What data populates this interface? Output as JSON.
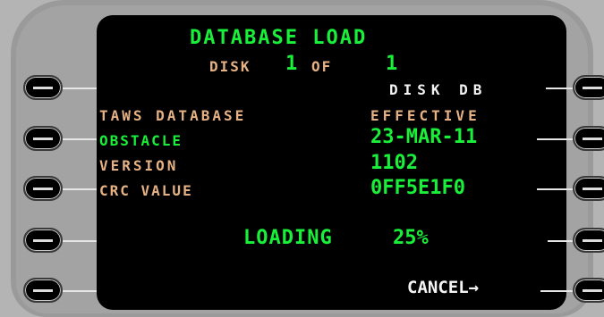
{
  "header": {
    "title": "DATABASE LOAD",
    "disk_label": "DISK",
    "disk_current": "1",
    "disk_of": "OF",
    "disk_total": "1"
  },
  "left_lines": {
    "taws_database": "TAWS DATABASE",
    "obstacle": "OBSTACLE",
    "version": "VERSION",
    "crc_value": "CRC VALUE"
  },
  "right_lines": {
    "disk_db": "DISK DB",
    "effective": "EFFECTIVE",
    "effective_date": "23-MAR-11",
    "version_value": "1102",
    "crc_value": "0FF5E1F0"
  },
  "status": {
    "loading_label": "LOADING",
    "loading_percent": "25%"
  },
  "actions": {
    "cancel_label": "CANCEL",
    "cancel_arrow": "→"
  },
  "colors": {
    "green": "#19f03a",
    "amber": "#e6b183",
    "white": "#f4f4f4",
    "screen": "#000000"
  }
}
